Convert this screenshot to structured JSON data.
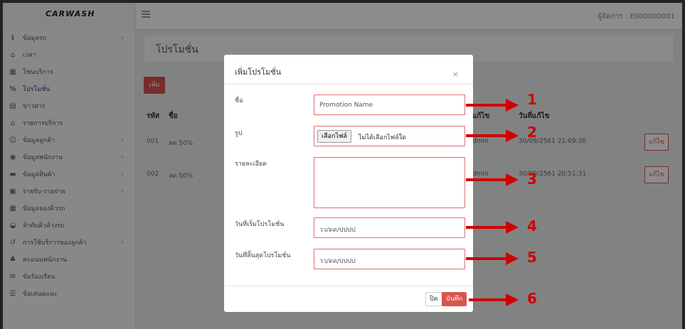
{
  "topbar": {
    "logo_text": "CARWASH",
    "user_label": "ผู้จัดการ : E000000001"
  },
  "sidebar": {
    "items": [
      {
        "label": "ข้อมูลรถ",
        "icon": "info-icon",
        "chevron": true,
        "active": false
      },
      {
        "label": "เวลา",
        "icon": "bank-icon",
        "chevron": false,
        "active": false
      },
      {
        "label": "โซนบริการ",
        "icon": "grid-icon",
        "chevron": false,
        "active": false
      },
      {
        "label": "โปรโมชั่น",
        "icon": "percent-icon",
        "chevron": false,
        "active": true
      },
      {
        "label": "ข่าวสาร",
        "icon": "news-icon",
        "chevron": false,
        "active": false
      },
      {
        "label": "รายการบริการ",
        "icon": "bank-icon",
        "chevron": false,
        "active": false
      },
      {
        "label": "ข้อมูลลูกค้า",
        "icon": "users-icon",
        "chevron": true,
        "active": false
      },
      {
        "label": "ข้อมูลพนักงาน",
        "icon": "user-circle-icon",
        "chevron": true,
        "active": false
      },
      {
        "label": "ข้อมูลสินค้า",
        "icon": "box-icon",
        "chevron": true,
        "active": false
      },
      {
        "label": "รายรับ-รายจ่าย",
        "icon": "money-icon",
        "chevron": true,
        "active": false
      },
      {
        "label": "ข้อมูลจองคิวรถ",
        "icon": "calendar-icon",
        "chevron": false,
        "active": false
      },
      {
        "label": "ลำดับคิวล้างรถ",
        "icon": "car-icon",
        "chevron": false,
        "active": false
      },
      {
        "label": "การใช้บริการของลูกค้า",
        "icon": "history-icon",
        "chevron": true,
        "active": false
      },
      {
        "label": "คะแนนพนักงาน",
        "icon": "thumbs-up-icon",
        "chevron": false,
        "active": false
      },
      {
        "label": "ข้อร้องเรียน",
        "icon": "complaint-icon",
        "chevron": false,
        "active": false
      },
      {
        "label": "ข้อเสนอแนะ",
        "icon": "list-icon",
        "chevron": false,
        "active": false
      }
    ]
  },
  "page": {
    "title": "โปรโมชั่น",
    "add_button": "เพิ่ม",
    "table": {
      "headers": [
        "รหัส",
        "ชื่อ",
        "ผู้แก้ไข",
        "วันที่แก้ไข"
      ],
      "rows": [
        {
          "id": "001",
          "name": "ลด 50%",
          "editor": "Admin",
          "edited_at": "30/09/2561 21:09:30",
          "action": "แก้ไข"
        },
        {
          "id": "002",
          "name": "ลด 50%",
          "editor": "Admin",
          "edited_at": "30/09/2561 20:51:31",
          "action": "แก้ไข"
        }
      ]
    }
  },
  "modal": {
    "title": "เพิ่มโปรโมชั่น",
    "close_symbol": "×",
    "fields": {
      "name_label": "ชื่อ",
      "name_placeholder": "Promotion Name",
      "image_label": "รูป",
      "file_button": "เลือกไฟล์",
      "file_status": "ไม่ได้เลือกไฟล์ใด",
      "detail_label": "รายละเอียด",
      "start_label": "วันที่เริ่มโปรโมชั่น",
      "start_placeholder": "วว/ดด/ปปปป",
      "end_label": "วันที่สิ้นสุดโปรโมชั่น",
      "end_placeholder": "วว/ดด/ปปปป"
    },
    "close_button": "ปิด",
    "save_button": "บันทึก"
  },
  "annotations": [
    "1",
    "2",
    "3",
    "4",
    "5",
    "6"
  ],
  "colors": {
    "accent": "#d9534f",
    "annotation": "#d00000",
    "active_nav": "#1f3a86"
  }
}
